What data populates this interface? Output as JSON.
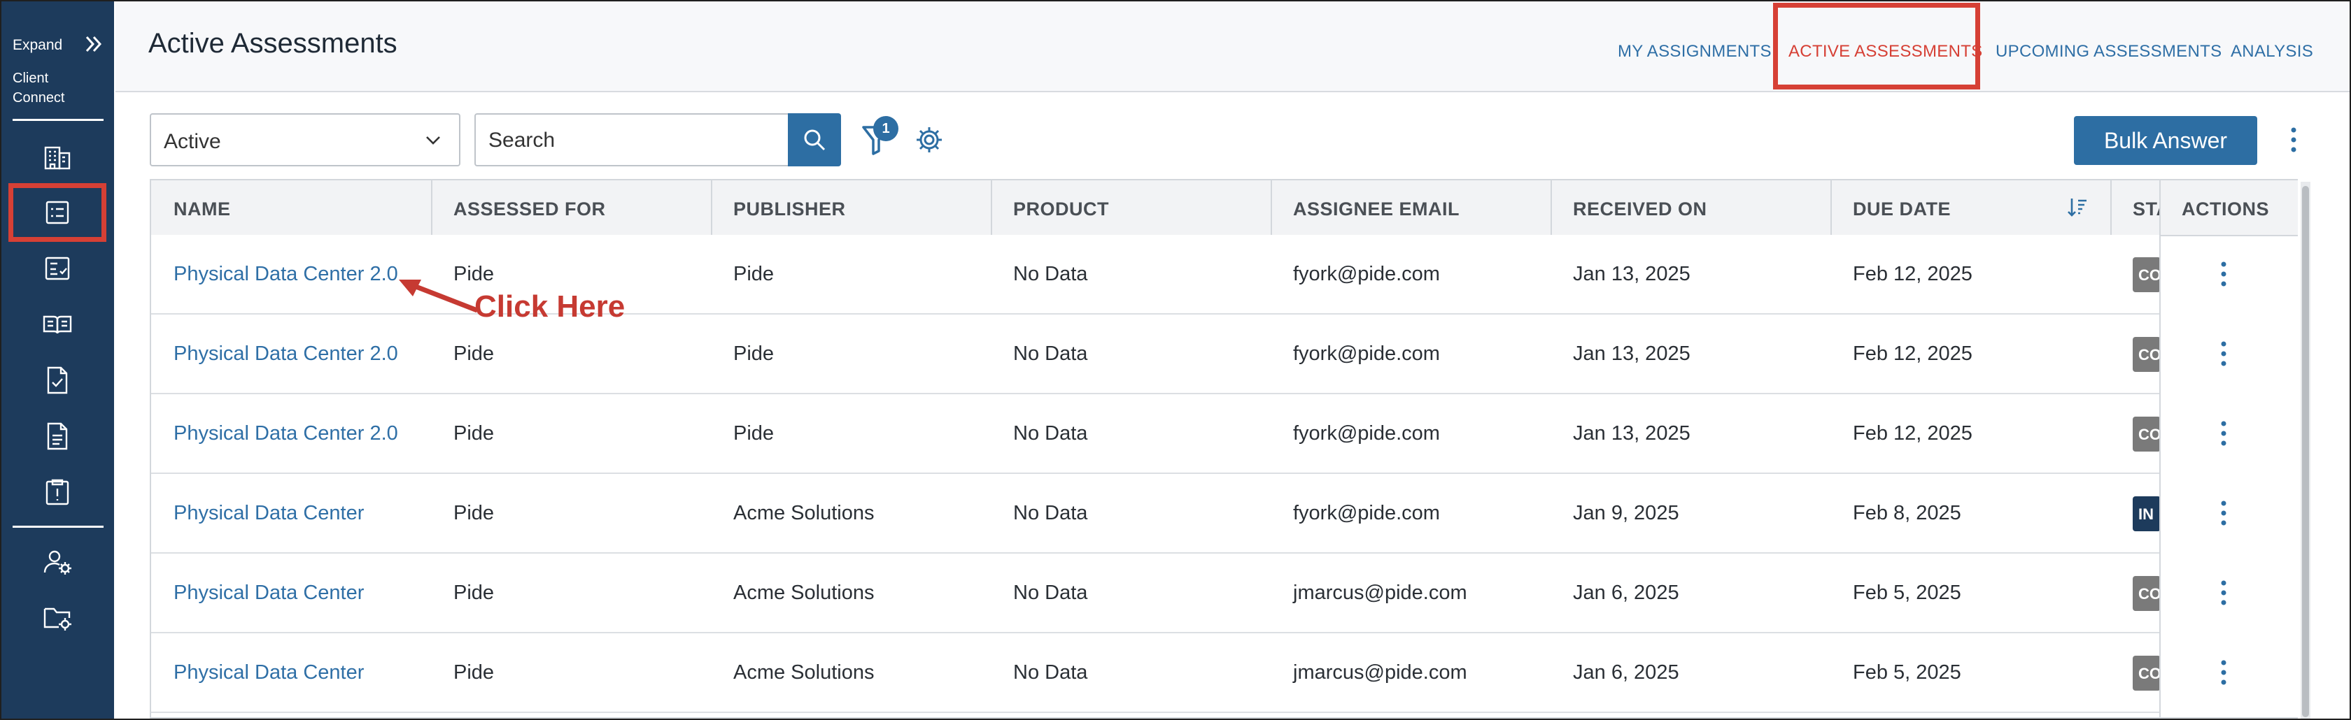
{
  "sidebar": {
    "expand_label": "Expand",
    "client_label_line1": "Client",
    "client_label_line2": "Connect",
    "icons": [
      "buildings-icon",
      "assessment-list-icon",
      "checklist-icon",
      "book-icon",
      "document-check-icon",
      "document-icon",
      "alert-document-icon",
      "user-settings-icon",
      "folder-settings-icon"
    ]
  },
  "header": {
    "title": "Active Assessments",
    "tabs": [
      {
        "label": "MY ASSIGNMENTS"
      },
      {
        "label": "ACTIVE ASSESSMENTS"
      },
      {
        "label": "UPCOMING ASSESSMENTS"
      },
      {
        "label": "ANALYSIS"
      }
    ],
    "active_tab": "ACTIVE ASSESSMENTS"
  },
  "toolbar": {
    "status_filter_value": "Active",
    "search_placeholder": "Search",
    "filter_count": "1",
    "bulk_answer_label": "Bulk Answer"
  },
  "table": {
    "columns": [
      "NAME",
      "ASSESSED FOR",
      "PUBLISHER",
      "PRODUCT",
      "ASSIGNEE EMAIL",
      "RECEIVED ON",
      "DUE DATE",
      "STA",
      "ACTIONS"
    ],
    "rows": [
      {
        "name": "Physical Data Center 2.0",
        "assessed_for": "Pide",
        "publisher": "Pide",
        "product": "No Data",
        "email": "fyork@pide.com",
        "received": "Jan 13, 2025",
        "due": "Feb 12, 2025",
        "status": "CO"
      },
      {
        "name": "Physical Data Center 2.0",
        "assessed_for": "Pide",
        "publisher": "Pide",
        "product": "No Data",
        "email": "fyork@pide.com",
        "received": "Jan 13, 2025",
        "due": "Feb 12, 2025",
        "status": "CO"
      },
      {
        "name": "Physical Data Center 2.0",
        "assessed_for": "Pide",
        "publisher": "Pide",
        "product": "No Data",
        "email": "fyork@pide.com",
        "received": "Jan 13, 2025",
        "due": "Feb 12, 2025",
        "status": "CO"
      },
      {
        "name": "Physical Data Center",
        "assessed_for": "Pide",
        "publisher": "Acme Solutions",
        "product": "No Data",
        "email": "fyork@pide.com",
        "received": "Jan 9, 2025",
        "due": "Feb 8, 2025",
        "status": "IN"
      },
      {
        "name": "Physical Data Center",
        "assessed_for": "Pide",
        "publisher": "Acme Solutions",
        "product": "No Data",
        "email": "jmarcus@pide.com",
        "received": "Jan 6, 2025",
        "due": "Feb 5, 2025",
        "status": "CO"
      },
      {
        "name": "Physical Data Center",
        "assessed_for": "Pide",
        "publisher": "Acme Solutions",
        "product": "No Data",
        "email": "jmarcus@pide.com",
        "received": "Jan 6, 2025",
        "due": "Feb 5, 2025",
        "status": "CO"
      }
    ]
  },
  "annotation": {
    "text": "Click Here"
  },
  "colors": {
    "sidebar": "#1d3b5c",
    "accent": "#2d6ea3",
    "highlight": "#d64035",
    "link": "#2f6fa6"
  }
}
